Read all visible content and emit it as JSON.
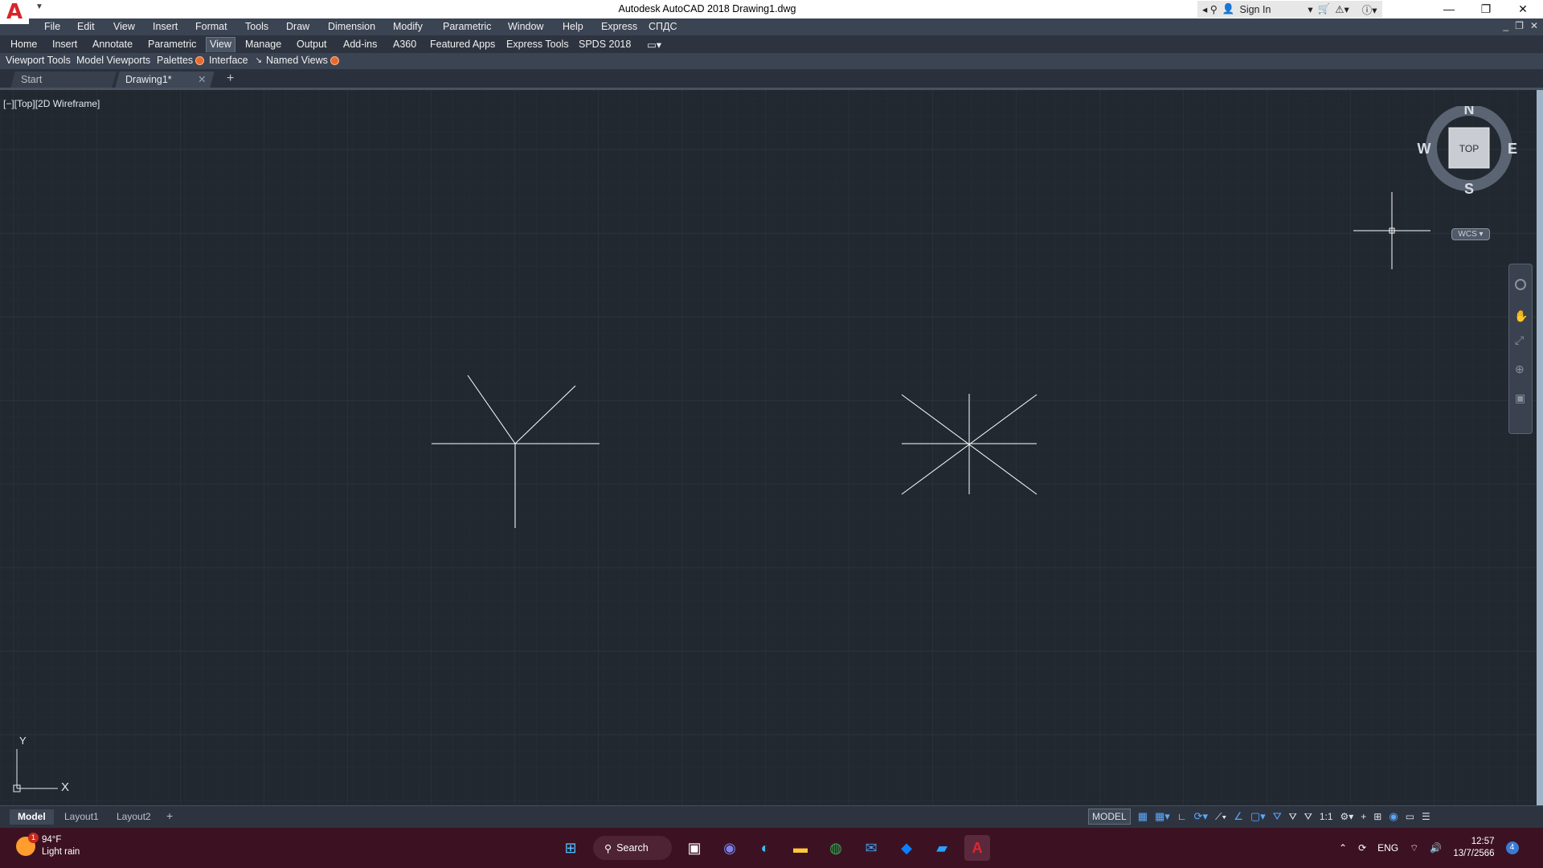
{
  "titlebar": {
    "title": "Autodesk AutoCAD 2018    Drawing1.dwg",
    "sign_in": "Sign In",
    "logo_letter": "A"
  },
  "menubar": {
    "items": [
      "File",
      "Edit",
      "View",
      "Insert",
      "Format",
      "Tools",
      "Draw",
      "Dimension",
      "Modify",
      "Parametric",
      "Window",
      "Help",
      "Express",
      "СПДС"
    ]
  },
  "ribbon": {
    "tabs": [
      "Home",
      "Insert",
      "Annotate",
      "Parametric",
      "View",
      "Manage",
      "Output",
      "Add-ins",
      "A360",
      "Featured Apps",
      "Express Tools",
      "SPDS 2018"
    ],
    "active_tab": "View",
    "panels": [
      "Viewport Tools",
      "Model Viewports",
      "Palettes",
      "Interface",
      "Named Views"
    ]
  },
  "file_tabs": {
    "start": "Start",
    "document": "Drawing1*",
    "add": "+"
  },
  "viewport": {
    "label": "[−][Top][2D Wireframe]",
    "viewcube": {
      "n": "N",
      "s": "S",
      "e": "E",
      "w": "W",
      "face": "TOP"
    },
    "wcs": "WCS",
    "ucs": {
      "x": "X",
      "y": "Y"
    }
  },
  "layout_tabs": {
    "tabs": [
      "Model",
      "Layout1",
      "Layout2"
    ],
    "add": "+"
  },
  "statusbar": {
    "model": "MODEL",
    "scale": "1:1"
  },
  "taskbar": {
    "weather_temp": "94°F",
    "weather_desc": "Light rain",
    "weather_badge": "1",
    "search": "Search",
    "lang": "ENG",
    "time": "12:57",
    "date": "13/7/2566",
    "notification_count": "4"
  },
  "colors": {
    "canvas": "#212830",
    "grid_minor": "#262e38",
    "grid_major": "#2e3744",
    "geometry": "#ffffff",
    "accent_orange": "#e8692d",
    "taskbar": "#3c1223"
  }
}
